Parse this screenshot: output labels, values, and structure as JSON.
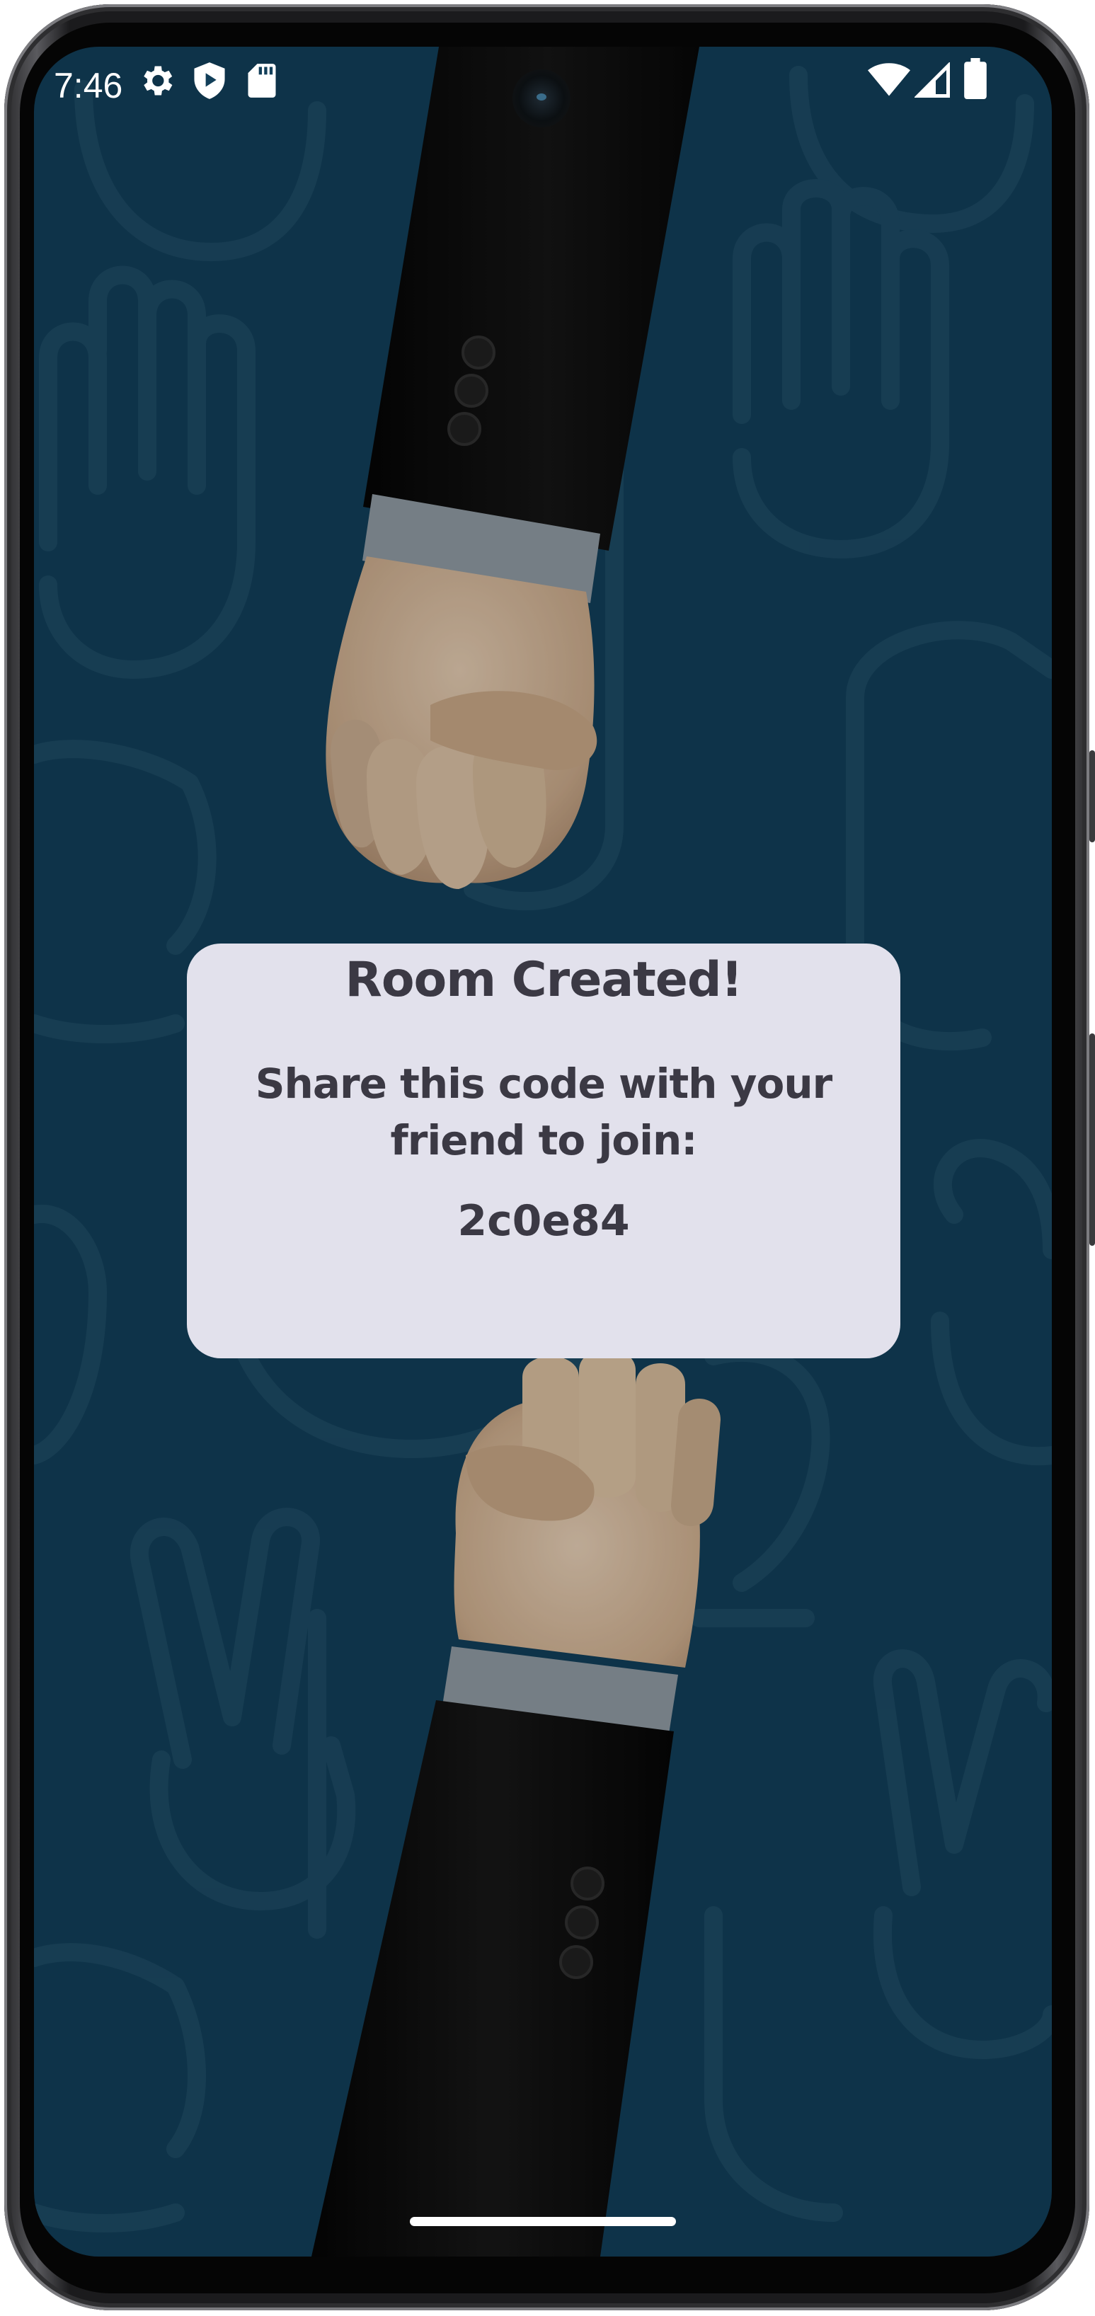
{
  "status_bar": {
    "time": "7:46",
    "left_icons": [
      "settings-gear-icon",
      "shield-play-icon",
      "sd-card-icon"
    ],
    "right_icons": [
      "wifi-icon",
      "cellular-signal-icon",
      "battery-icon"
    ]
  },
  "dialog": {
    "title": "Room Created!",
    "message": "Share this code with your friend to join:",
    "room_code": "2c0e84"
  },
  "colors": {
    "screen_background": "#123f59",
    "dialog_background": "#e2e1ec",
    "dialog_text": "#3b3944",
    "suit": "#0e0e0f",
    "skin": "#d9bfa4"
  }
}
